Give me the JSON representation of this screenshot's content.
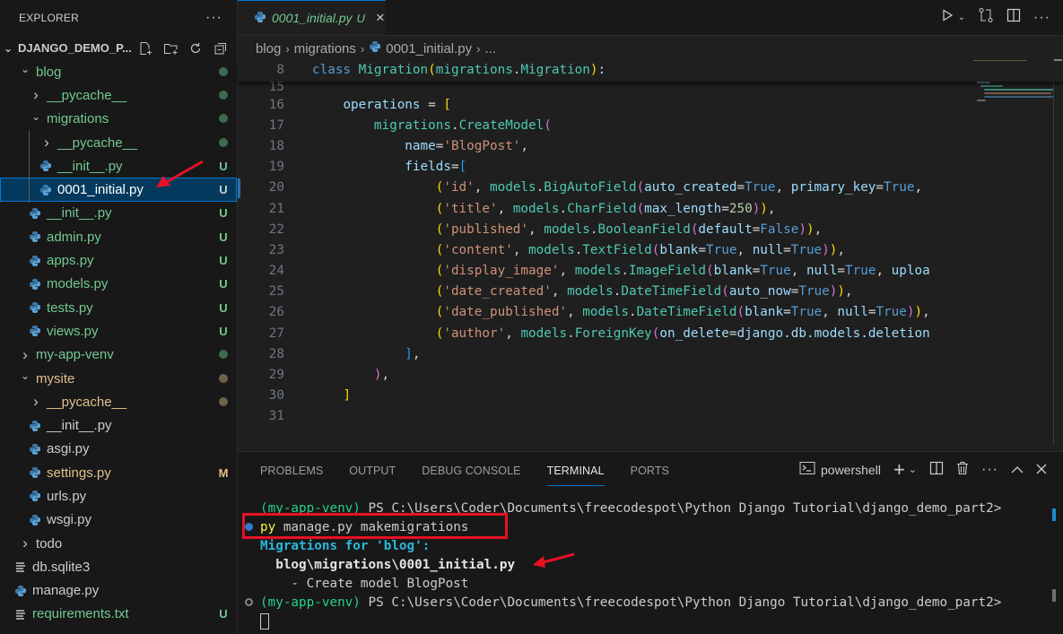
{
  "sidebar": {
    "title": "EXPLORER",
    "more_icon": "ellipsis-icon",
    "root": {
      "name": "DJANGO_DEMO_P...",
      "actions": [
        "new-file-icon",
        "new-folder-icon",
        "refresh-icon",
        "collapse-all-icon"
      ]
    },
    "tree": [
      {
        "label": "blog",
        "type": "folder",
        "expanded": true,
        "depth": 0,
        "color": "green",
        "status": "dot"
      },
      {
        "label": "__pycache__",
        "type": "folder",
        "expanded": false,
        "depth": 1,
        "color": "green",
        "status": "dot"
      },
      {
        "label": "migrations",
        "type": "folder",
        "expanded": true,
        "depth": 1,
        "color": "green",
        "status": "dot"
      },
      {
        "label": "__pycache__",
        "type": "folder",
        "expanded": false,
        "depth": 2,
        "color": "green",
        "status": "dot"
      },
      {
        "label": "__init__.py",
        "type": "python",
        "depth": 2,
        "color": "green",
        "status": "U"
      },
      {
        "label": "0001_initial.py",
        "type": "python",
        "depth": 2,
        "color": "white",
        "status": "U",
        "selected": true
      },
      {
        "label": "__init__.py",
        "type": "python",
        "depth": 1,
        "color": "green",
        "status": "U"
      },
      {
        "label": "admin.py",
        "type": "python",
        "depth": 1,
        "color": "green",
        "status": "U"
      },
      {
        "label": "apps.py",
        "type": "python",
        "depth": 1,
        "color": "green",
        "status": "U"
      },
      {
        "label": "models.py",
        "type": "python",
        "depth": 1,
        "color": "green",
        "status": "U"
      },
      {
        "label": "tests.py",
        "type": "python",
        "depth": 1,
        "color": "green",
        "status": "U"
      },
      {
        "label": "views.py",
        "type": "python",
        "depth": 1,
        "color": "green",
        "status": "U"
      },
      {
        "label": "my-app-venv",
        "type": "folder",
        "expanded": false,
        "depth": 0,
        "color": "green",
        "status": "dot"
      },
      {
        "label": "mysite",
        "type": "folder",
        "expanded": true,
        "depth": 0,
        "color": "yellow",
        "status": "dot-yellow"
      },
      {
        "label": "__pycache__",
        "type": "folder",
        "expanded": false,
        "depth": 1,
        "color": "yellow",
        "status": "dot-yellow"
      },
      {
        "label": "__init__.py",
        "type": "python",
        "depth": 1,
        "color": "white",
        "status": ""
      },
      {
        "label": "asgi.py",
        "type": "python",
        "depth": 1,
        "color": "white",
        "status": ""
      },
      {
        "label": "settings.py",
        "type": "python",
        "depth": 1,
        "color": "yellow",
        "status": "M"
      },
      {
        "label": "urls.py",
        "type": "python",
        "depth": 1,
        "color": "white",
        "status": ""
      },
      {
        "label": "wsgi.py",
        "type": "python",
        "depth": 1,
        "color": "white",
        "status": ""
      },
      {
        "label": "todo",
        "type": "folder",
        "expanded": false,
        "depth": 0,
        "color": "white",
        "status": ""
      },
      {
        "label": "db.sqlite3",
        "type": "text",
        "depth": 0,
        "color": "white",
        "status": ""
      },
      {
        "label": "manage.py",
        "type": "python",
        "depth": 0,
        "color": "white",
        "status": ""
      },
      {
        "label": "requirements.txt",
        "type": "text",
        "depth": 0,
        "color": "green",
        "status": "U"
      }
    ]
  },
  "editor": {
    "tab": {
      "title": "0001_initial.py",
      "status": "U",
      "close": "×"
    },
    "actions": [
      "run-icon",
      "chevron-down-icon",
      "compare-changes-icon",
      "split-editor-icon",
      "ellipsis-icon"
    ],
    "breadcrumb": [
      "blog",
      "migrations",
      "0001_initial.py",
      "..."
    ],
    "sticky_line": {
      "number": "8",
      "tokens": [
        [
          "kw",
          "class "
        ],
        [
          "cls",
          "Migration"
        ],
        [
          "b1",
          "("
        ],
        [
          "cls",
          "migrations"
        ],
        [
          "pl",
          "."
        ],
        [
          "cls",
          "Migration"
        ],
        [
          "b1",
          ")"
        ],
        [
          "pl",
          ":"
        ]
      ]
    },
    "lines": [
      {
        "number": "15",
        "tokens": []
      },
      {
        "number": "16",
        "tokens": [
          [
            "pl",
            "    "
          ],
          [
            "var",
            "operations"
          ],
          [
            "pl",
            " = "
          ],
          [
            "b1",
            "["
          ]
        ]
      },
      {
        "number": "17",
        "tokens": [
          [
            "pl",
            "        "
          ],
          [
            "cls",
            "migrations"
          ],
          [
            "pl",
            "."
          ],
          [
            "cls",
            "CreateModel"
          ],
          [
            "b2",
            "("
          ]
        ]
      },
      {
        "number": "18",
        "tokens": [
          [
            "pl",
            "            "
          ],
          [
            "var",
            "name"
          ],
          [
            "pl",
            "="
          ],
          [
            "str",
            "'BlogPost'"
          ],
          [
            "pl",
            ","
          ]
        ]
      },
      {
        "number": "19",
        "tokens": [
          [
            "pl",
            "            "
          ],
          [
            "var",
            "fields"
          ],
          [
            "pl",
            "="
          ],
          [
            "b3",
            "["
          ]
        ]
      },
      {
        "number": "20",
        "tokens": [
          [
            "pl",
            "                "
          ],
          [
            "b1",
            "("
          ],
          [
            "str",
            "'id'"
          ],
          [
            "pl",
            ", "
          ],
          [
            "cls",
            "models"
          ],
          [
            "pl",
            "."
          ],
          [
            "cls",
            "BigAutoField"
          ],
          [
            "b2",
            "("
          ],
          [
            "var",
            "auto_created"
          ],
          [
            "pl",
            "="
          ],
          [
            "bool",
            "True"
          ],
          [
            "pl",
            ", "
          ],
          [
            "var",
            "primary_key"
          ],
          [
            "pl",
            "="
          ],
          [
            "bool",
            "True"
          ],
          [
            "pl",
            ", "
          ]
        ]
      },
      {
        "number": "21",
        "tokens": [
          [
            "pl",
            "                "
          ],
          [
            "b1",
            "("
          ],
          [
            "str",
            "'title'"
          ],
          [
            "pl",
            ", "
          ],
          [
            "cls",
            "models"
          ],
          [
            "pl",
            "."
          ],
          [
            "cls",
            "CharField"
          ],
          [
            "b2",
            "("
          ],
          [
            "var",
            "max_length"
          ],
          [
            "pl",
            "="
          ],
          [
            "num",
            "250"
          ],
          [
            "b2",
            ")"
          ],
          [
            "b1",
            ")"
          ],
          [
            "pl",
            ","
          ]
        ]
      },
      {
        "number": "22",
        "tokens": [
          [
            "pl",
            "                "
          ],
          [
            "b1",
            "("
          ],
          [
            "str",
            "'published'"
          ],
          [
            "pl",
            ", "
          ],
          [
            "cls",
            "models"
          ],
          [
            "pl",
            "."
          ],
          [
            "cls",
            "BooleanField"
          ],
          [
            "b2",
            "("
          ],
          [
            "var",
            "default"
          ],
          [
            "pl",
            "="
          ],
          [
            "bool",
            "False"
          ],
          [
            "b2",
            ")"
          ],
          [
            "b1",
            ")"
          ],
          [
            "pl",
            ","
          ]
        ]
      },
      {
        "number": "23",
        "tokens": [
          [
            "pl",
            "                "
          ],
          [
            "b1",
            "("
          ],
          [
            "str",
            "'content'"
          ],
          [
            "pl",
            ", "
          ],
          [
            "cls",
            "models"
          ],
          [
            "pl",
            "."
          ],
          [
            "cls",
            "TextField"
          ],
          [
            "b2",
            "("
          ],
          [
            "var",
            "blank"
          ],
          [
            "pl",
            "="
          ],
          [
            "bool",
            "True"
          ],
          [
            "pl",
            ", "
          ],
          [
            "var",
            "null"
          ],
          [
            "pl",
            "="
          ],
          [
            "bool",
            "True"
          ],
          [
            "b2",
            ")"
          ],
          [
            "b1",
            ")"
          ],
          [
            "pl",
            ","
          ]
        ]
      },
      {
        "number": "24",
        "tokens": [
          [
            "pl",
            "                "
          ],
          [
            "b1",
            "("
          ],
          [
            "str",
            "'display_image'"
          ],
          [
            "pl",
            ", "
          ],
          [
            "cls",
            "models"
          ],
          [
            "pl",
            "."
          ],
          [
            "cls",
            "ImageField"
          ],
          [
            "b2",
            "("
          ],
          [
            "var",
            "blank"
          ],
          [
            "pl",
            "="
          ],
          [
            "bool",
            "True"
          ],
          [
            "pl",
            ", "
          ],
          [
            "var",
            "null"
          ],
          [
            "pl",
            "="
          ],
          [
            "bool",
            "True"
          ],
          [
            "pl",
            ", "
          ],
          [
            "var",
            "uploa"
          ]
        ]
      },
      {
        "number": "25",
        "tokens": [
          [
            "pl",
            "                "
          ],
          [
            "b1",
            "("
          ],
          [
            "str",
            "'date_created'"
          ],
          [
            "pl",
            ", "
          ],
          [
            "cls",
            "models"
          ],
          [
            "pl",
            "."
          ],
          [
            "cls",
            "DateTimeField"
          ],
          [
            "b2",
            "("
          ],
          [
            "var",
            "auto_now"
          ],
          [
            "pl",
            "="
          ],
          [
            "bool",
            "True"
          ],
          [
            "b2",
            ")"
          ],
          [
            "b1",
            ")"
          ],
          [
            "pl",
            ","
          ]
        ]
      },
      {
        "number": "26",
        "tokens": [
          [
            "pl",
            "                "
          ],
          [
            "b1",
            "("
          ],
          [
            "str",
            "'date_published'"
          ],
          [
            "pl",
            ", "
          ],
          [
            "cls",
            "models"
          ],
          [
            "pl",
            "."
          ],
          [
            "cls",
            "DateTimeField"
          ],
          [
            "b2",
            "("
          ],
          [
            "var",
            "blank"
          ],
          [
            "pl",
            "="
          ],
          [
            "bool",
            "True"
          ],
          [
            "pl",
            ", "
          ],
          [
            "var",
            "null"
          ],
          [
            "pl",
            "="
          ],
          [
            "bool",
            "True"
          ],
          [
            "b2",
            ")"
          ],
          [
            "b1",
            ")"
          ],
          [
            "pl",
            ","
          ]
        ]
      },
      {
        "number": "27",
        "tokens": [
          [
            "pl",
            "                "
          ],
          [
            "b1",
            "("
          ],
          [
            "str",
            "'author'"
          ],
          [
            "pl",
            ", "
          ],
          [
            "cls",
            "models"
          ],
          [
            "pl",
            "."
          ],
          [
            "cls",
            "ForeignKey"
          ],
          [
            "b2",
            "("
          ],
          [
            "var",
            "on_delete"
          ],
          [
            "pl",
            "="
          ],
          [
            "var",
            "django"
          ],
          [
            "pl",
            "."
          ],
          [
            "var",
            "db"
          ],
          [
            "pl",
            "."
          ],
          [
            "var",
            "models"
          ],
          [
            "pl",
            "."
          ],
          [
            "var",
            "deletion"
          ]
        ]
      },
      {
        "number": "28",
        "tokens": [
          [
            "pl",
            "            "
          ],
          [
            "b3",
            "]"
          ],
          [
            "pl",
            ","
          ]
        ]
      },
      {
        "number": "29",
        "tokens": [
          [
            "pl",
            "        "
          ],
          [
            "b2",
            ")"
          ],
          [
            "pl",
            ","
          ]
        ]
      },
      {
        "number": "30",
        "tokens": [
          [
            "pl",
            "    "
          ],
          [
            "b1",
            "]"
          ]
        ]
      },
      {
        "number": "31",
        "tokens": []
      }
    ]
  },
  "panel": {
    "tabs": [
      "PROBLEMS",
      "OUTPUT",
      "DEBUG CONSOLE",
      "TERMINAL",
      "PORTS"
    ],
    "active_tab": "TERMINAL",
    "shell_label": "powershell",
    "actions": [
      "new-terminal-icon",
      "chevron-down-icon",
      "split-terminal-icon",
      "trash-icon",
      "ellipsis-icon",
      "maximize-icon",
      "close-icon"
    ],
    "terminal": {
      "prompt_env": "(my-app-venv)",
      "prompt_path": " PS C:\\Users\\Coder\\Documents\\freecodespot\\Python Django Tutorial\\django_demo_part2>",
      "command_head": "py",
      "command_rest": " manage.py makemigrations",
      "output_header": "Migrations for 'blog':",
      "output_file": "  blog\\migrations\\0001_initial.py",
      "output_action": "    - Create model BlogPost"
    }
  },
  "colors": {
    "accent": "#0078d4",
    "git_untracked": "#73c991",
    "git_modified": "#e2c08d",
    "annotation_red": "#e81123"
  }
}
